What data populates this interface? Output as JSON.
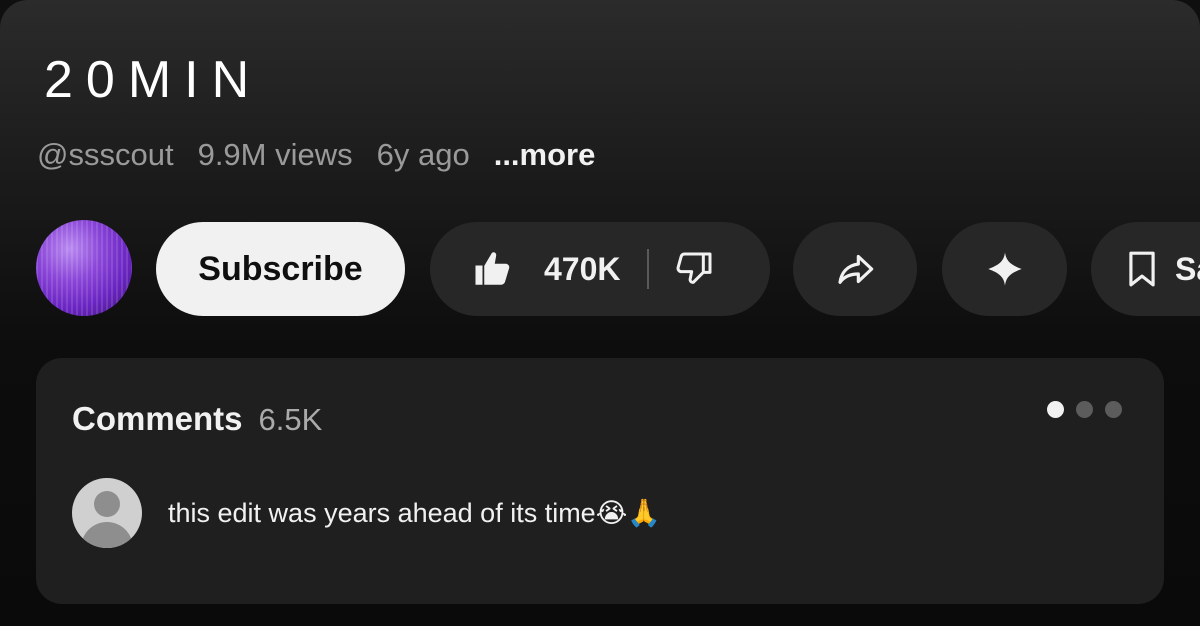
{
  "video": {
    "title": "20MIN",
    "channel": "@ssscout",
    "views": "9.9M views",
    "age": "6y ago",
    "more_label": "...more"
  },
  "actions": {
    "subscribe_label": "Subscribe",
    "like_count": "470K",
    "save_label": "Save"
  },
  "comments": {
    "title": "Comments",
    "count": "6.5K",
    "top_comment": {
      "text": "this edit was years ahead of its time😭🙏"
    },
    "pager": {
      "total": 3,
      "active": 1
    }
  },
  "icons": {
    "like": "thumbs-up-icon",
    "dislike": "thumbs-down-icon",
    "share": "share-icon",
    "remix": "sparkle-icon",
    "save": "bookmark-icon"
  },
  "colors": {
    "background": "#0f0f0f",
    "pill": "#272727",
    "subscribe_bg": "#f1f1f1",
    "comments_panel": "#1f1f1f",
    "muted_text": "#9a9a9a"
  }
}
